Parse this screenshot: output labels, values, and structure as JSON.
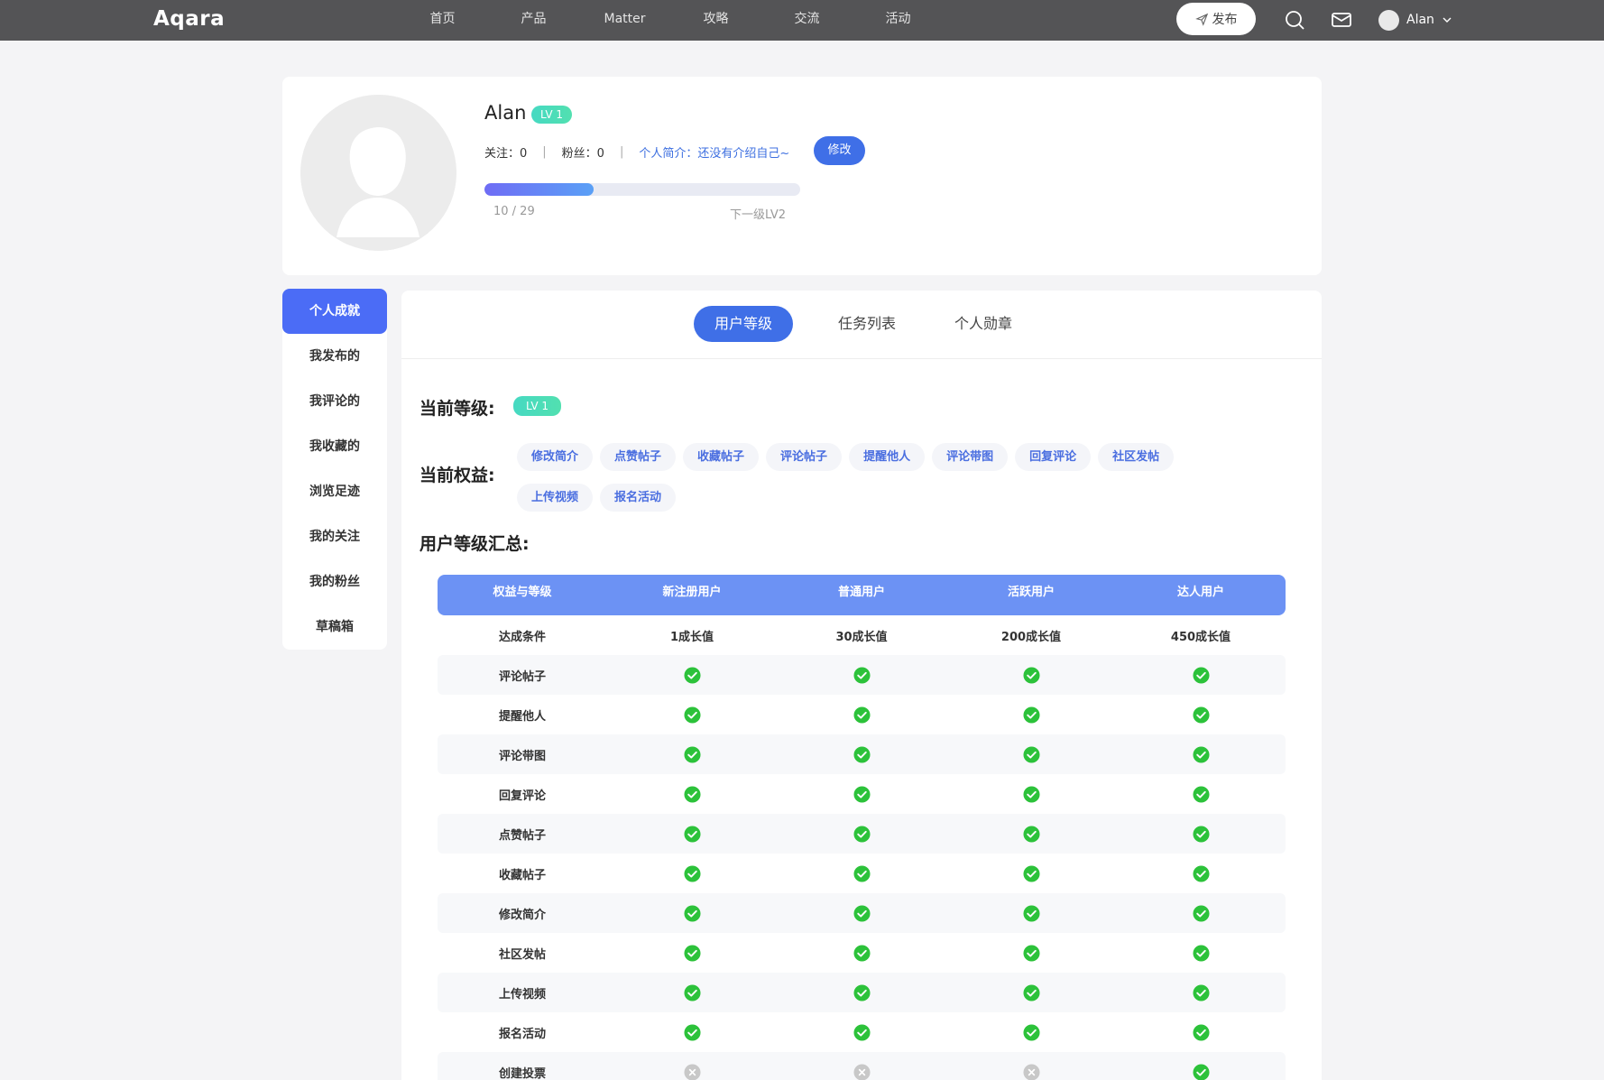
{
  "nav": {
    "logo": "Aqara",
    "items": [
      "首页",
      "产品",
      "Matter",
      "攻略",
      "交流",
      "活动"
    ],
    "publish_label": "发布",
    "user_name": "Alan"
  },
  "profile": {
    "name": "Alan",
    "level": "LV 1",
    "follow_label": "关注：0",
    "fans_label": "粉丝：0",
    "bio": "个人简介：还没有介绍自己~",
    "edit_label": "修改",
    "progress_text": "10 / 29",
    "progress_fraction": 0.345,
    "next_level": "下一级LV2"
  },
  "sidebar": {
    "items": [
      "个人成就",
      "我发布的",
      "我评论的",
      "我收藏的",
      "浏览足迹",
      "我的关注",
      "我的粉丝",
      "草稿箱"
    ],
    "active_index": 0
  },
  "tabs": {
    "items": [
      "用户等级",
      "任务列表",
      "个人勋章"
    ],
    "active_index": 0
  },
  "level_section": {
    "current_level_label": "当前等级:",
    "current_level": "LV 1",
    "rights_label": "当前权益:",
    "rights": [
      "修改简介",
      "点赞帖子",
      "收藏帖子",
      "评论帖子",
      "提醒他人",
      "评论带图",
      "回复评论",
      "社区发帖",
      "上传视频",
      "报名活动"
    ],
    "summary_label": "用户等级汇总:"
  },
  "table": {
    "headers": [
      "权益与等级",
      "新注册用户",
      "普通用户",
      "活跃用户",
      "达人用户"
    ],
    "condition_row": [
      "达成条件",
      "1成长值",
      "30成长值",
      "200成长值",
      "450成长值"
    ],
    "rows": [
      {
        "name": "评论帖子",
        "values": [
          true,
          true,
          true,
          true
        ]
      },
      {
        "name": "提醒他人",
        "values": [
          true,
          true,
          true,
          true
        ]
      },
      {
        "name": "评论带图",
        "values": [
          true,
          true,
          true,
          true
        ]
      },
      {
        "name": "回复评论",
        "values": [
          true,
          true,
          true,
          true
        ]
      },
      {
        "name": "点赞帖子",
        "values": [
          true,
          true,
          true,
          true
        ]
      },
      {
        "name": "收藏帖子",
        "values": [
          true,
          true,
          true,
          true
        ]
      },
      {
        "name": "修改简介",
        "values": [
          true,
          true,
          true,
          true
        ]
      },
      {
        "name": "社区发帖",
        "values": [
          true,
          true,
          true,
          true
        ]
      },
      {
        "name": "上传视频",
        "values": [
          true,
          true,
          true,
          true
        ]
      },
      {
        "name": "报名活动",
        "values": [
          true,
          true,
          true,
          true
        ]
      },
      {
        "name": "创建投票",
        "values": [
          false,
          false,
          false,
          true
        ]
      }
    ]
  },
  "colors": {
    "accent": "#3f6fe7",
    "check_on": "#2cc23a",
    "check_off": "#c8c8c8"
  }
}
